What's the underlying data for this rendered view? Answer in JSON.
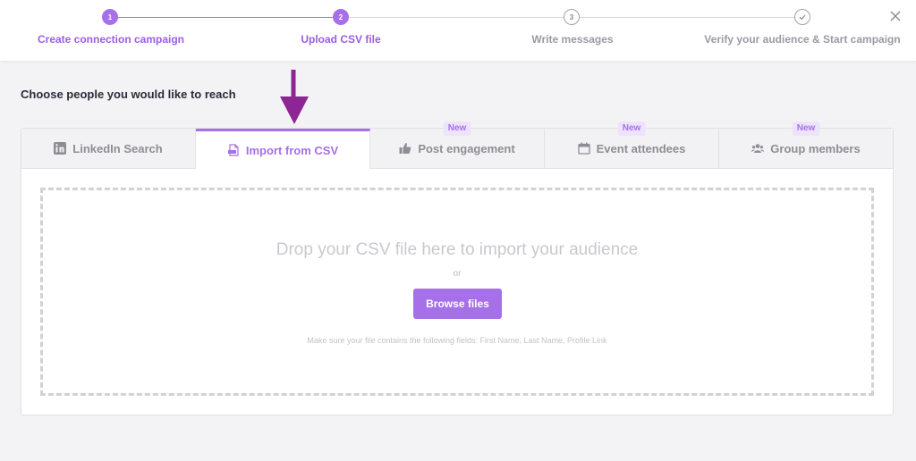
{
  "stepper": {
    "steps": [
      {
        "number": "1",
        "label": "Create connection campaign",
        "state": "active"
      },
      {
        "number": "2",
        "label": "Upload CSV file",
        "state": "active"
      },
      {
        "number": "3",
        "label": "Write messages",
        "state": "inactive"
      },
      {
        "number": "",
        "label": "Verify your audience & Start campaign",
        "state": "inactive",
        "icon": "check-icon"
      }
    ]
  },
  "headline": "Choose people you would like to reach",
  "tabs": [
    {
      "label": "LinkedIn Search",
      "icon": "linkedin-icon",
      "badge": "",
      "active": false
    },
    {
      "label": "Import from CSV",
      "icon": "csv-file-icon",
      "badge": "",
      "active": true
    },
    {
      "label": "Post engagement",
      "icon": "thumbs-up-icon",
      "badge": "New",
      "active": false
    },
    {
      "label": "Event attendees",
      "icon": "calendar-icon",
      "badge": "New",
      "active": false
    },
    {
      "label": "Group members",
      "icon": "users-icon",
      "badge": "New",
      "active": false
    }
  ],
  "dropzone": {
    "title": "Drop your CSV file here to import your audience",
    "or": "or",
    "button": "Browse files",
    "hint": "Make sure your file contains the following fields: First Name, Last Name, Profile Link"
  },
  "colors": {
    "accent": "#a670e8",
    "arrow": "#8e2594"
  }
}
